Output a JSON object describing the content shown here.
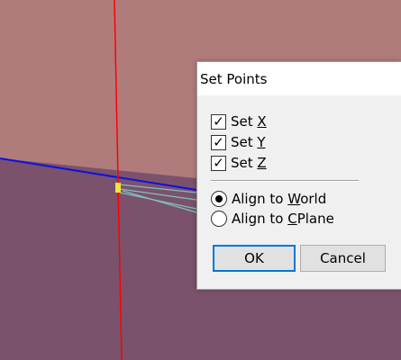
{
  "viewport": {
    "background_color": "#b07c7b",
    "ground_color": "#7a526b",
    "x_axis_color": "#ff0000",
    "horizon_color": "#1010e0",
    "geometry_color": "#80c0c0",
    "point_color": "#e8e840"
  },
  "dialog": {
    "title": "Set Points",
    "checkboxes": [
      {
        "prefix": "Set ",
        "mnemonic": "X",
        "checked": true
      },
      {
        "prefix": "Set ",
        "mnemonic": "Y",
        "checked": true
      },
      {
        "prefix": "Set ",
        "mnemonic": "Z",
        "checked": true
      }
    ],
    "radios": [
      {
        "prefix": "Align to ",
        "mnemonic": "W",
        "suffix": "orld",
        "selected": true
      },
      {
        "prefix": "Align to ",
        "mnemonic": "C",
        "suffix": "Plane",
        "selected": false
      }
    ],
    "ok_label": "OK",
    "cancel_label": "Cancel",
    "check_glyph": "✓"
  }
}
